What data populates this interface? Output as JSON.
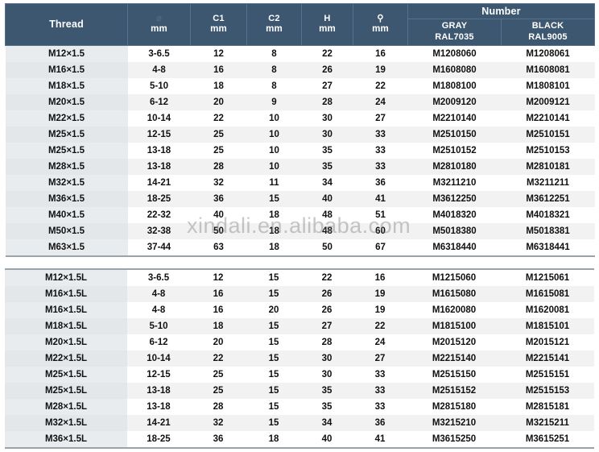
{
  "header": {
    "thread_label": "Thread",
    "columns": [
      {
        "symbol": "⌀",
        "symbol_name": "cable-diameter-icon",
        "unit": "mm",
        "faint": true
      },
      {
        "symbol": "C1",
        "symbol_name": "c1-label",
        "unit": "mm",
        "faint": false
      },
      {
        "symbol": "C2",
        "symbol_name": "c2-label",
        "unit": "mm",
        "faint": false
      },
      {
        "symbol": "H",
        "symbol_name": "h-label",
        "unit": "mm",
        "faint": false
      },
      {
        "symbol": "⚲",
        "symbol_name": "spanner-icon",
        "unit": "mm",
        "faint": false
      }
    ],
    "number_label": "Number",
    "gray_line1": "GRAY",
    "gray_line2": "RAL7035",
    "black_line1": "BLACK",
    "black_line2": "RAL9005"
  },
  "colors": {
    "header_bg": "#3d5770",
    "header_text": "#ffffff",
    "row_even_bg": "#f2f2f2",
    "row_odd_bg": "#ffffff",
    "thread_col_bg": "#e9ecee",
    "rule": "#9aa3aa"
  },
  "watermark": {
    "text": "xindali.en.alibaba.com"
  },
  "table_standard": {
    "rows": [
      {
        "thread": "M12×1.5",
        "range": "3-6.5",
        "c1": "12",
        "c2": "8",
        "h": "22",
        "spanner": "16",
        "gray": "M1208060",
        "black": "M1208061"
      },
      {
        "thread": "M16×1.5",
        "range": "4-8",
        "c1": "16",
        "c2": "8",
        "h": "26",
        "spanner": "19",
        "gray": "M1608080",
        "black": "M1608081"
      },
      {
        "thread": "M18×1.5",
        "range": "5-10",
        "c1": "18",
        "c2": "8",
        "h": "27",
        "spanner": "22",
        "gray": "M1808100",
        "black": "M1808101"
      },
      {
        "thread": "M20×1.5",
        "range": "6-12",
        "c1": "20",
        "c2": "9",
        "h": "28",
        "spanner": "24",
        "gray": "M2009120",
        "black": "M2009121"
      },
      {
        "thread": "M22×1.5",
        "range": "10-14",
        "c1": "22",
        "c2": "10",
        "h": "30",
        "spanner": "27",
        "gray": "M2210140",
        "black": "M2210141"
      },
      {
        "thread": "M25×1.5",
        "range": "12-15",
        "c1": "25",
        "c2": "10",
        "h": "30",
        "spanner": "33",
        "gray": "M2510150",
        "black": "M2510151"
      },
      {
        "thread": "M25×1.5",
        "range": "13-18",
        "c1": "25",
        "c2": "10",
        "h": "35",
        "spanner": "33",
        "gray": "M2510152",
        "black": "M2510153"
      },
      {
        "thread": "M28×1.5",
        "range": "13-18",
        "c1": "28",
        "c2": "10",
        "h": "35",
        "spanner": "33",
        "gray": "M2810180",
        "black": "M2810181"
      },
      {
        "thread": "M32×1.5",
        "range": "14-21",
        "c1": "32",
        "c2": "11",
        "h": "34",
        "spanner": "36",
        "gray": "M3211210",
        "black": "M3211211"
      },
      {
        "thread": "M36×1.5",
        "range": "18-25",
        "c1": "36",
        "c2": "15",
        "h": "40",
        "spanner": "41",
        "gray": "M3612250",
        "black": "M3612251"
      },
      {
        "thread": "M40×1.5",
        "range": "22-32",
        "c1": "40",
        "c2": "18",
        "h": "48",
        "spanner": "51",
        "gray": "M4018320",
        "black": "M4018321"
      },
      {
        "thread": "M50×1.5",
        "range": "32-38",
        "c1": "50",
        "c2": "18",
        "h": "48",
        "spanner": "60",
        "gray": "M5018380",
        "black": "M5018381"
      },
      {
        "thread": "M63×1.5",
        "range": "37-44",
        "c1": "63",
        "c2": "18",
        "h": "50",
        "spanner": "67",
        "gray": "M6318440",
        "black": "M6318441"
      }
    ]
  },
  "table_long": {
    "rows": [
      {
        "thread": "M12×1.5L",
        "range": "3-6.5",
        "c1": "12",
        "c2": "15",
        "h": "22",
        "spanner": "16",
        "gray": "M1215060",
        "black": "M1215061"
      },
      {
        "thread": "M16×1.5L",
        "range": "4-8",
        "c1": "16",
        "c2": "15",
        "h": "26",
        "spanner": "19",
        "gray": "M1615080",
        "black": "M1615081"
      },
      {
        "thread": "M16×1.5L",
        "range": "4-8",
        "c1": "16",
        "c2": "20",
        "h": "26",
        "spanner": "19",
        "gray": "M1620080",
        "black": "M1620081"
      },
      {
        "thread": "M18×1.5L",
        "range": "5-10",
        "c1": "18",
        "c2": "15",
        "h": "27",
        "spanner": "22",
        "gray": "M1815100",
        "black": "M1815101"
      },
      {
        "thread": "M20×1.5L",
        "range": "6-12",
        "c1": "20",
        "c2": "15",
        "h": "28",
        "spanner": "24",
        "gray": "M2015120",
        "black": "M2015121"
      },
      {
        "thread": "M22×1.5L",
        "range": "10-14",
        "c1": "22",
        "c2": "15",
        "h": "30",
        "spanner": "27",
        "gray": "M2215140",
        "black": "M2215141"
      },
      {
        "thread": "M25×1.5L",
        "range": "12-15",
        "c1": "25",
        "c2": "15",
        "h": "30",
        "spanner": "33",
        "gray": "M2515150",
        "black": "M2515151"
      },
      {
        "thread": "M25×1.5L",
        "range": "13-18",
        "c1": "25",
        "c2": "15",
        "h": "35",
        "spanner": "33",
        "gray": "M2515152",
        "black": "M2515153"
      },
      {
        "thread": "M28×1.5L",
        "range": "13-18",
        "c1": "28",
        "c2": "15",
        "h": "35",
        "spanner": "33",
        "gray": "M2815180",
        "black": "M2815181"
      },
      {
        "thread": "M32×1.5L",
        "range": "14-21",
        "c1": "32",
        "c2": "15",
        "h": "34",
        "spanner": "36",
        "gray": "M3215210",
        "black": "M3215211"
      },
      {
        "thread": "M36×1.5L",
        "range": "18-25",
        "c1": "36",
        "c2": "18",
        "h": "40",
        "spanner": "41",
        "gray": "M3615250",
        "black": "M3615251"
      }
    ]
  }
}
